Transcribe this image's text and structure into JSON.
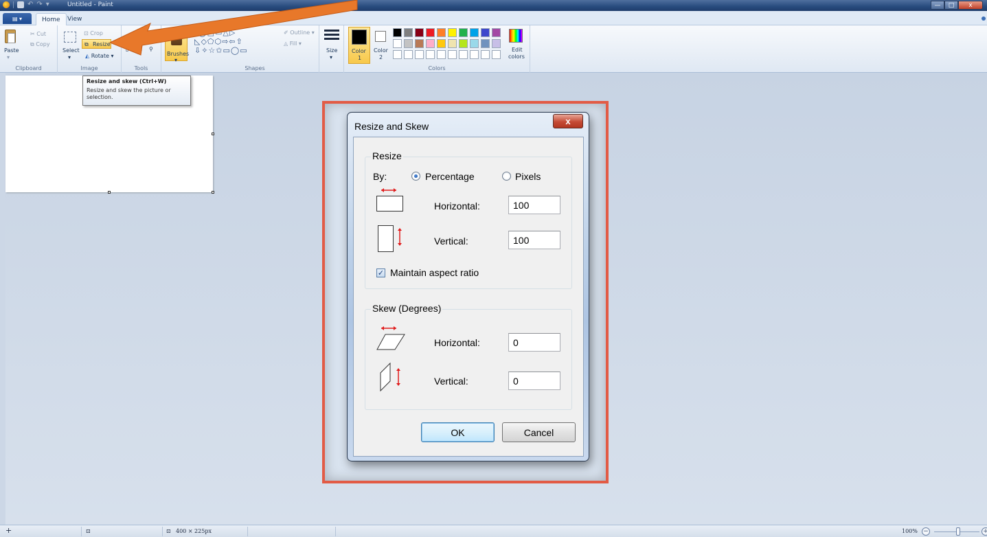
{
  "window": {
    "title": "Untitled - Paint",
    "min_glyph": "—",
    "max_glyph": "□",
    "close_glyph": "x"
  },
  "ribbon": {
    "file_button": "▤ ▾",
    "tabs": [
      "Home",
      "View"
    ],
    "clipboard": {
      "paste": "Paste",
      "cut": "Cut",
      "copy": "Copy",
      "label": "Clipboard"
    },
    "image": {
      "select": "Select",
      "crop": "Crop",
      "resize": "Resize",
      "rotate": "Rotate",
      "label": "Image"
    },
    "tools": {
      "label": "Tools"
    },
    "brushes": "Brushes",
    "shapes": {
      "outline": "Outline",
      "fill": "Fill",
      "label": "Shapes",
      "row1": "◟◯□▭△▷",
      "row2": "◺◇⬠⬡⇨⇦⇧",
      "row3": "⇩✧☆✩▭◯▭"
    },
    "size": "Size",
    "colors": {
      "color1": "Color",
      "color1_num": "1",
      "color2": "Color",
      "color2_num": "2",
      "edit": "Edit",
      "edit2": "colors",
      "label": "Colors",
      "palette": [
        "#000000",
        "#7f7f7f",
        "#880015",
        "#ed1c24",
        "#ff7f27",
        "#fff200",
        "#22b14c",
        "#00a2e8",
        "#3f48cc",
        "#a349a4",
        "#ffffff",
        "#c3c3c3",
        "#b97a57",
        "#ffaec9",
        "#ffc90e",
        "#efe4b0",
        "#b5e61d",
        "#99d9ea",
        "#7092be",
        "#c8bfe7",
        "#ffffff",
        "#ffffff",
        "#ffffff",
        "#ffffff",
        "#ffffff",
        "#ffffff",
        "#ffffff",
        "#ffffff",
        "#ffffff",
        "#ffffff"
      ]
    }
  },
  "tooltip": {
    "title": "Resize and skew (Ctrl+W)",
    "description": "Resize and skew the picture or selection."
  },
  "dialog": {
    "title": "Resize and Skew",
    "close": "x",
    "resize": {
      "legend": "Resize",
      "by_label": "By:",
      "option_percentage": "Percentage",
      "option_pixels": "Pixels",
      "selected": "Percentage",
      "horizontal_label": "Horizontal:",
      "horizontal_value": "100",
      "vertical_label": "Vertical:",
      "vertical_value": "100",
      "maintain_aspect_label": "Maintain aspect ratio",
      "maintain_aspect_checked": true
    },
    "skew": {
      "legend": "Skew (Degrees)",
      "horizontal_label": "Horizontal:",
      "horizontal_value": "0",
      "vertical_label": "Vertical:",
      "vertical_value": "0"
    },
    "ok": "OK",
    "cancel": "Cancel"
  },
  "statusbar": {
    "canvas_size": "400 × 225px",
    "zoom": "100%"
  },
  "colors": {
    "highlight_frame": "#e25b45",
    "annotation_arrow": "#e8782a"
  }
}
